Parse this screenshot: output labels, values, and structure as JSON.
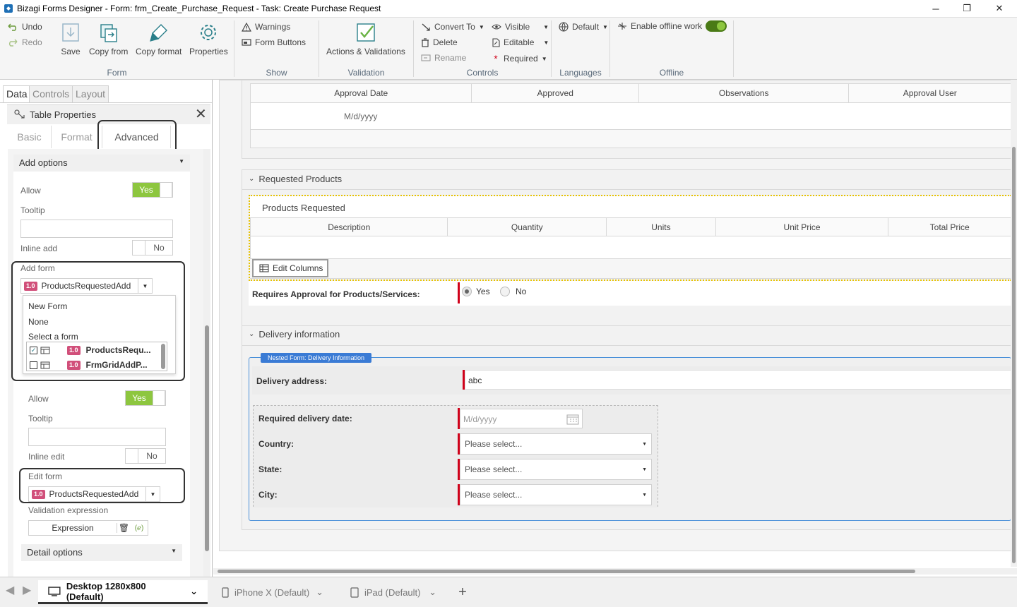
{
  "window": {
    "title": "Bizagi Forms Designer  -  Form: frm_Create_Purchase_Request - Task:  Create Purchase Request",
    "controls": [
      "─",
      "❐",
      "✕"
    ]
  },
  "ribbon": {
    "form": {
      "undo": "Undo",
      "redo": "Redo",
      "save": "Save",
      "copy_from": "Copy from",
      "copy_format": "Copy format",
      "properties": "Properties",
      "label": "Form"
    },
    "show": {
      "warnings": "Warnings",
      "form_buttons": "Form Buttons",
      "label": "Show"
    },
    "validation": {
      "actions": "Actions & Validations",
      "label": "Validation"
    },
    "controls": {
      "convert_to": "Convert To",
      "delete": "Delete",
      "rename": "Rename",
      "visible": "Visible",
      "editable": "Editable",
      "required": "Required",
      "label": "Controls"
    },
    "languages": {
      "default": "Default",
      "label": "Languages"
    },
    "offline": {
      "enable": "Enable offline work",
      "label": "Offline"
    }
  },
  "left_panel": {
    "tabs": [
      "Data",
      "Controls",
      "Layout"
    ],
    "properties_title": "Table Properties",
    "subtabs": [
      "Basic",
      "Format",
      "Advanced"
    ],
    "add_options": {
      "header": "Add options",
      "allow_label": "Allow",
      "allow_value": "Yes",
      "tooltip_label": "Tooltip",
      "inline_add_label": "Inline add",
      "inline_add_value": "No",
      "add_form_label": "Add form",
      "add_form_version": "1.0",
      "add_form_value": "ProductsRequestedAdd"
    },
    "dropdown": {
      "items": [
        "New Form",
        "None"
      ],
      "select_label": "Select a form",
      "forms": [
        {
          "version": "1.0",
          "name": "ProductsRequ...",
          "checked": true
        },
        {
          "version": "1.0",
          "name": "FrmGridAddP...",
          "checked": false
        }
      ]
    },
    "edit_options": {
      "allow_label": "Allow",
      "allow_value": "Yes",
      "tooltip_label": "Tooltip",
      "inline_edit_label": "Inline edit",
      "inline_edit_value": "No",
      "edit_form_label": "Edit form",
      "edit_form_version": "1.0",
      "edit_form_value": "ProductsRequestedAdd",
      "validation_label": "Validation expression",
      "expression_btn": "Expression"
    },
    "detail_options": {
      "header": "Detail options"
    }
  },
  "canvas": {
    "approval_grid": {
      "columns": [
        "Approval Date",
        "Approved",
        "Observations",
        "Approval User"
      ],
      "row_placeholder": "M/d/yyyy"
    },
    "requested_products": {
      "group_title": "Requested Products",
      "grid_title": "Products Requested",
      "columns": [
        "Description",
        "Quantity",
        "Units",
        "Unit Price",
        "Total Price"
      ],
      "edit_columns": "Edit Columns"
    },
    "requires_approval": {
      "label": "Requires Approval for Products/Services:",
      "yes": "Yes",
      "no": "No"
    },
    "delivery": {
      "group_title": "Delivery information",
      "nested_badge": "Nested Form: Delivery Information",
      "address_label": "Delivery address:",
      "address_value": "abc",
      "date_label": "Required delivery date:",
      "date_placeholder": "M/d/yyyy",
      "country_label": "Country:",
      "state_label": "State:",
      "city_label": "City:",
      "select_placeholder": "Please select..."
    }
  },
  "device_bar": {
    "tabs": [
      {
        "label": "Desktop 1280x800 (Default)",
        "active": true
      },
      {
        "label": "iPhone X (Default)",
        "active": false
      },
      {
        "label": "iPad (Default)",
        "active": false
      }
    ],
    "add": "+"
  }
}
